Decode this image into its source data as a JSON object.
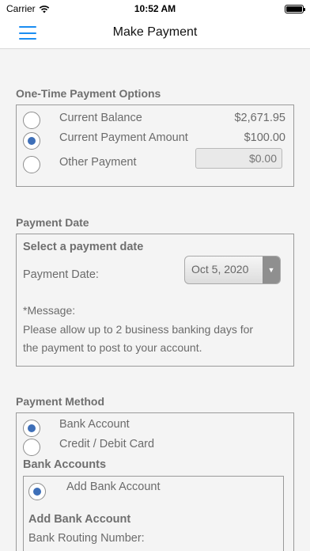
{
  "status_bar": {
    "carrier": "Carrier",
    "time": "10:52 AM"
  },
  "nav": {
    "title": "Make Payment",
    "menu_icon": "hamburger-menu-icon"
  },
  "one_time": {
    "title": "One-Time Payment Options",
    "options": [
      {
        "label": "Current Balance",
        "amount": "$2,671.95",
        "selected": false
      },
      {
        "label": "Current Payment Amount",
        "amount": "$100.00",
        "selected": true
      },
      {
        "label": "Other Payment",
        "amount_placeholder": "$0.00",
        "selected": false
      }
    ]
  },
  "payment_date": {
    "title": "Payment Date",
    "subheading": "Select a payment date",
    "date_label": "Payment Date:",
    "date_value": "Oct 5, 2020",
    "message_label": "*Message:",
    "message_line1": "Please allow up to 2 business banking days for",
    "message_line2": "the payment to post to your account."
  },
  "payment_method": {
    "title": "Payment Method",
    "options": [
      {
        "label": "Bank Account",
        "selected": true
      },
      {
        "label": "Credit / Debit Card",
        "selected": false
      }
    ],
    "bank_accounts_heading": "Bank Accounts",
    "add_bank_option": {
      "label": "Add Bank Account",
      "selected": true
    },
    "add_bank_heading": "Add Bank Account",
    "routing_label": "Bank Routing Number:"
  }
}
